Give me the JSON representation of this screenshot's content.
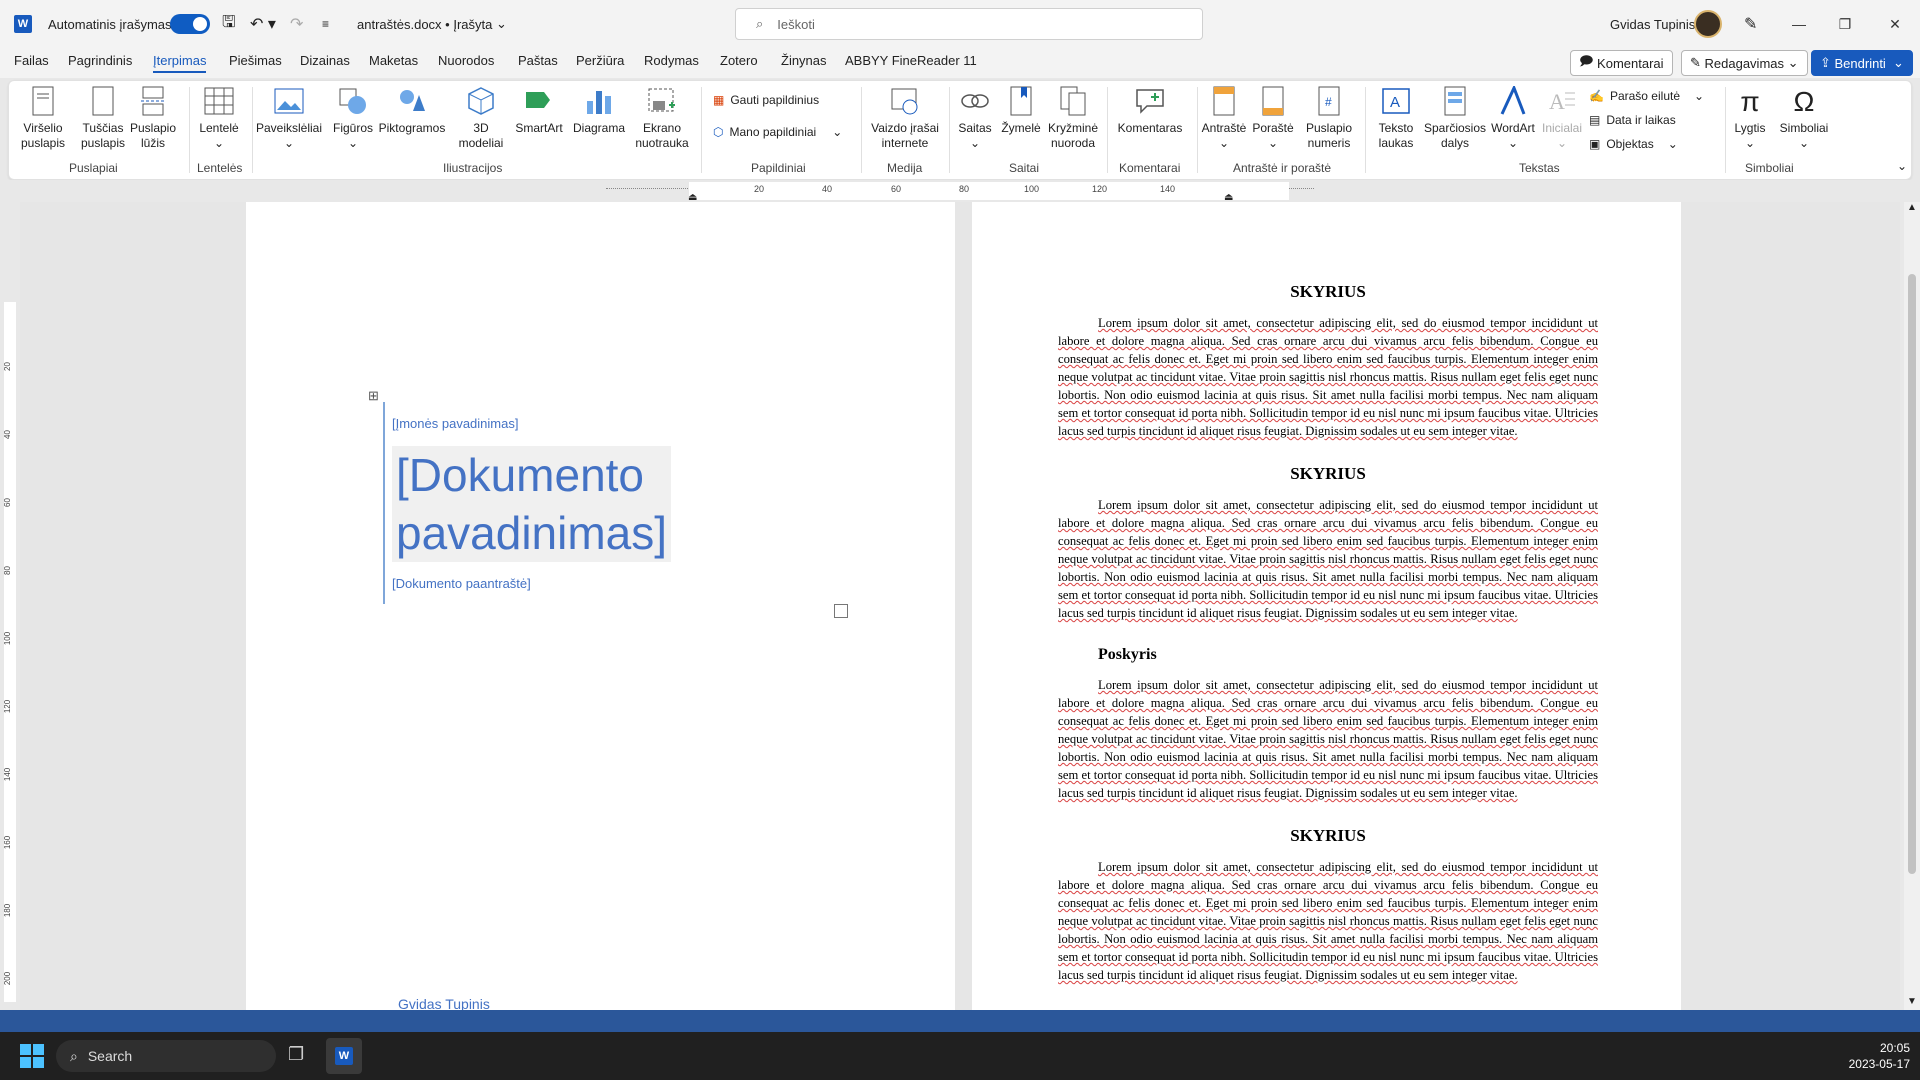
{
  "titlebar": {
    "autosave_label": "Automatinis įrašymas",
    "doc_name": "antraštės.docx",
    "doc_status": "• Įrašyta",
    "search_placeholder": "Ieškoti",
    "user_name": "Gvidas Tupinis"
  },
  "tabs": [
    "Failas",
    "Pagrindinis",
    "Įterpimas",
    "Piešimas",
    "Dizainas",
    "Maketas",
    "Nuorodos",
    "Paštas",
    "Peržiūra",
    "Rodymas",
    "Zotero",
    "Žinynas",
    "ABBYY FineReader 11"
  ],
  "header_buttons": {
    "comments": "Komentarai",
    "editing": "Redagavimas",
    "share": "Bendrinti"
  },
  "ribbon": {
    "buttons": [
      {
        "l1": "Viršelio",
        "l2": "puslapis"
      },
      {
        "l1": "Tuščias",
        "l2": "puslapis"
      },
      {
        "l1": "Puslapio",
        "l2": "lūžis"
      },
      {
        "l1": "Lentelė",
        "l2": ""
      },
      {
        "l1": "Paveikslėliai",
        "l2": ""
      },
      {
        "l1": "Figūros",
        "l2": ""
      },
      {
        "l1": "Piktogramos",
        "l2": ""
      },
      {
        "l1": "3D",
        "l2": "modeliai"
      },
      {
        "l1": "SmartArt",
        "l2": ""
      },
      {
        "l1": "Diagrama",
        "l2": ""
      },
      {
        "l1": "Ekrano",
        "l2": "nuotrauka"
      },
      {
        "l1": "Vaizdo įrašai",
        "l2": "internete"
      },
      {
        "l1": "Saitas",
        "l2": ""
      },
      {
        "l1": "Žymelė",
        "l2": ""
      },
      {
        "l1": "Kryžminė",
        "l2": "nuoroda"
      },
      {
        "l1": "Komentaras",
        "l2": ""
      },
      {
        "l1": "Antraštė",
        "l2": ""
      },
      {
        "l1": "Poraštė",
        "l2": ""
      },
      {
        "l1": "Puslapio",
        "l2": "numeris"
      },
      {
        "l1": "Teksto",
        "l2": "laukas"
      },
      {
        "l1": "Sparčiosios",
        "l2": "dalys"
      },
      {
        "l1": "WordArt",
        "l2": ""
      },
      {
        "l1": "Inicialai",
        "l2": ""
      },
      {
        "l1": "Lygtis",
        "l2": ""
      },
      {
        "l1": "Simboliai",
        "l2": ""
      }
    ],
    "small": {
      "get_addins": "Gauti papildinius",
      "my_addins": "Mano papildiniai",
      "signature_line": "Parašo eilutė",
      "date_time": "Data ir laikas",
      "object": "Objektas"
    },
    "groups": [
      "Puslapiai",
      "Lentelės",
      "Iliustracijos",
      "Papildiniai",
      "Medija",
      "Saitai",
      "Komentarai",
      "Antraštė ir poraštė",
      "Tekstas",
      "Simboliai"
    ]
  },
  "ruler_top": [
    "20",
    "40",
    "60",
    "80",
    "100",
    "120",
    "140"
  ],
  "ruler_left": [
    "20",
    "40",
    "60",
    "80",
    "100",
    "120",
    "140",
    "160",
    "180",
    "200"
  ],
  "cover": {
    "company": "[Įmonės pavadinimas]",
    "title_line1": "[Dokumento",
    "title_line2": "pavadinimas]",
    "subtitle": "[Dokumento paantraštė]",
    "author": "Gvidas Tupinis"
  },
  "content": {
    "blocks": [
      {
        "heading": "SKYRIUS",
        "level": 1
      },
      {
        "heading": "SKYRIUS",
        "level": 1
      },
      {
        "heading": "Poskyris",
        "level": 2
      },
      {
        "heading": "SKYRIUS",
        "level": 1
      }
    ],
    "paragraph": "Lorem ipsum dolor sit amet, consectetur adipiscing elit, sed do eiusmod tempor incididunt ut labore et dolore magna aliqua. Sed cras ornare arcu dui vivamus arcu felis bibendum. Congue eu consequat ac felis donec et. Eget mi proin sed libero enim sed faucibus turpis. Elementum integer enim neque volutpat ac tincidunt vitae. Vitae proin sagittis nisl rhoncus mattis. Risus nullam eget felis eget nunc lobortis. Non odio euismod lacinia at quis risus. Sit amet nulla facilisi morbi tempus. Nec nam aliquam sem et tortor consequat id porta nibh. Sollicitudin tempor id eu nisl nunc mi ipsum faucibus vitae. Ultricies lacus sed turpis tincidunt id aliquet risus feugiat. Dignissim sodales ut eu sem integer vitae."
  },
  "taskbar": {
    "search": "Search",
    "time": "20:05",
    "date": "2023-05-17"
  },
  "colors": {
    "accent": "#185abd",
    "statusbar": "#2b579a",
    "cover_text": "#4472c4"
  }
}
